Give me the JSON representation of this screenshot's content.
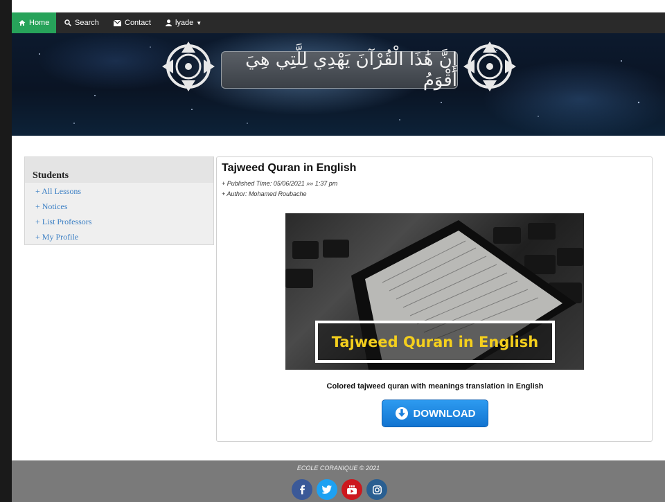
{
  "nav": {
    "home": "Home",
    "search": "Search",
    "contact": "Contact",
    "user": "lyade"
  },
  "banner": {
    "calligraphy": "إِنَّ هَٰذَا الْقُرْآنَ يَهْدِي لِلَّتِي هِيَ أَقْوَمُ"
  },
  "sidebar": {
    "title": "Students",
    "items": [
      {
        "label": "+ All Lessons"
      },
      {
        "label": "+ Notices"
      },
      {
        "label": "+ List Professors"
      },
      {
        "label": "+ My Profile"
      }
    ]
  },
  "post": {
    "title": "Tajweed Quran in English",
    "published": "+ Published Time: 05/06/2021 »» 1:37 pm",
    "author": "+ Author: Mohamed Roubache",
    "image_caption": "Tajweed Quran in English",
    "description": "Colored tajweed quran with meanings translation in English",
    "download_label": "DOWNLOAD"
  },
  "footer": {
    "copyright": "ECOLE CORANIQUE © 2021",
    "social": [
      "facebook-icon",
      "twitter-icon",
      "youtube-icon",
      "instagram-icon"
    ]
  },
  "colors": {
    "nav_active": "#27a35a",
    "link": "#3b7fc4",
    "download": "#1a86e0",
    "caption": "#f4cf1d"
  }
}
